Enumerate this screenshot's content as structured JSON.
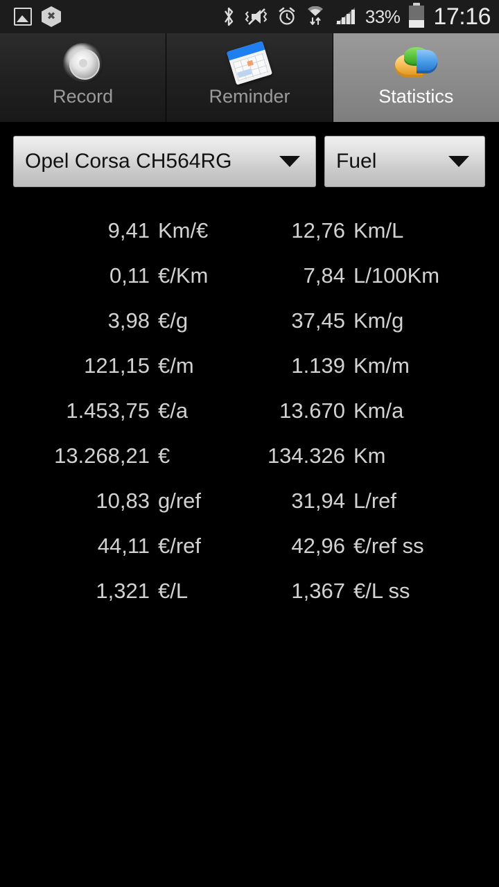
{
  "statusbar": {
    "notification_icons": [
      "screenshot-image-icon",
      "hexagon-app-icon"
    ],
    "system_icons": [
      "bluetooth-icon",
      "vibrate-mute-icon",
      "alarm-clock-icon",
      "wifi-data-icon",
      "signal-bars-icon"
    ],
    "battery_percent": "33%",
    "battery_level": 33,
    "clock": "17:16"
  },
  "tabs": [
    {
      "label": "Record",
      "icon": "wheel-icon",
      "active": false
    },
    {
      "label": "Reminder",
      "icon": "calendar-icon",
      "active": false
    },
    {
      "label": "Statistics",
      "icon": "pie-chart-icon",
      "active": true
    }
  ],
  "spinners": {
    "vehicle": {
      "value": "Opel Corsa CH564RG",
      "icon": "chevron-down-icon"
    },
    "type": {
      "value": "Fuel",
      "icon": "chevron-down-icon"
    }
  },
  "stats": {
    "rows": [
      {
        "left_value": "9,41",
        "left_unit": "Km/€",
        "right_value": "12,76",
        "right_unit": "Km/L"
      },
      {
        "left_value": "0,11",
        "left_unit": "€/Km",
        "right_value": "7,84",
        "right_unit": "L/100Km"
      },
      {
        "left_value": "3,98",
        "left_unit": "€/g",
        "right_value": "37,45",
        "right_unit": "Km/g"
      },
      {
        "left_value": "121,15",
        "left_unit": "€/m",
        "right_value": "1.139",
        "right_unit": "Km/m"
      },
      {
        "left_value": "1.453,75",
        "left_unit": "€/a",
        "right_value": "13.670",
        "right_unit": "Km/a"
      },
      {
        "left_value": "13.268,21",
        "left_unit": "€",
        "right_value": "134.326",
        "right_unit": "Km"
      },
      {
        "left_value": "10,83",
        "left_unit": "g/ref",
        "right_value": "31,94",
        "right_unit": "L/ref"
      },
      {
        "left_value": "44,11",
        "left_unit": "€/ref",
        "right_value": "42,96",
        "right_unit": "€/ref ss"
      },
      {
        "left_value": "1,321",
        "left_unit": "€/L",
        "right_value": "1,367",
        "right_unit": "€/L ss"
      }
    ]
  },
  "colors": {
    "background": "#000000",
    "statusbar_bg": "#1c1c1c",
    "tab_active_bg": "#8c8c8c",
    "tab_inactive_text": "#9b9b9b",
    "tab_active_text": "#ffffff",
    "spinner_bg": "#e2e2e2",
    "stat_text": "#d2d2d2"
  }
}
